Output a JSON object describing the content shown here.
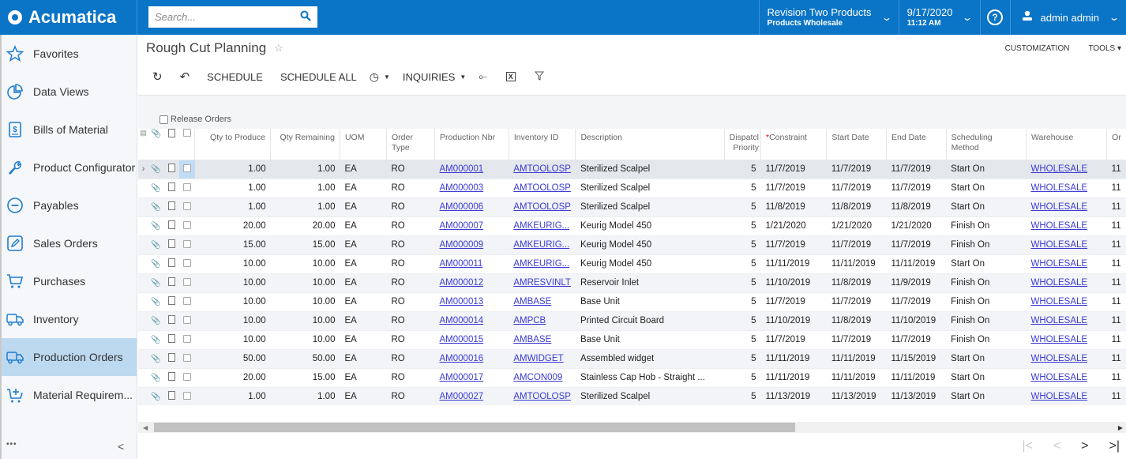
{
  "app": {
    "brand": "Acumatica"
  },
  "topbar": {
    "search_placeholder": "Search...",
    "company": {
      "line1": "Revision Two Products",
      "line2": "Products Wholesale"
    },
    "datetime": {
      "date": "9/17/2020",
      "time": "11:12 AM"
    },
    "help_label": "?",
    "user": "admin admin"
  },
  "sidebar": {
    "items": [
      {
        "label": "Favorites",
        "icon": "star-icon"
      },
      {
        "label": "Data Views",
        "icon": "pie-chart-icon"
      },
      {
        "label": "Bills of Material",
        "icon": "bill-icon"
      },
      {
        "label": "Product Configurator",
        "icon": "wrench-icon"
      },
      {
        "label": "Payables",
        "icon": "minus-circle-icon"
      },
      {
        "label": "Sales Orders",
        "icon": "edit-icon"
      },
      {
        "label": "Purchases",
        "icon": "cart-icon"
      },
      {
        "label": "Inventory",
        "icon": "truck-icon"
      },
      {
        "label": "Production Orders",
        "icon": "truck-icon",
        "active": true
      },
      {
        "label": "Material Requirem...",
        "icon": "cart-plus-icon"
      }
    ],
    "more_label": "•••",
    "collapse_label": "<"
  },
  "page": {
    "title": "Rough Cut Planning",
    "customization": "CUSTOMIZATION",
    "tools": "TOOLS"
  },
  "toolbar": {
    "schedule": "SCHEDULE",
    "schedule_all": "SCHEDULE ALL",
    "inquiries": "INQUIRIES"
  },
  "form": {
    "release_orders_label": "Release Orders",
    "release_orders_checked": false
  },
  "grid": {
    "columns": [
      "Qty to Produce",
      "Qty Remaining",
      "UOM",
      "Order Type",
      "Production Nbr",
      "Inventory ID",
      "Description",
      "Dispatch Priority",
      "Constraint",
      "Start Date",
      "End Date",
      "Scheduling Method",
      "Warehouse",
      "Or"
    ],
    "header": {
      "qty_to_produce": "Qty to Produce",
      "qty_remaining": "Qty Remaining",
      "uom": "UOM",
      "order_type": "Order Type",
      "production_nbr": "Production Nbr",
      "inventory_id": "Inventory ID",
      "description": "Description",
      "dispatch_priority": "Dispatcl Priority",
      "constraint": "Constraint",
      "start_date": "Start Date",
      "end_date": "End Date",
      "scheduling_method": "Scheduling Method",
      "warehouse": "Warehouse",
      "order_date": "Or"
    },
    "rows": [
      {
        "qty": "1.00",
        "rem": "1.00",
        "uom": "EA",
        "type": "RO",
        "nbr": "AM000001",
        "inv": "AMTOOLOSP",
        "desc": "Sterilized Scalpel",
        "prio": "5",
        "constraint": "11/7/2019",
        "start": "11/7/2019",
        "end": "11/7/2019",
        "method": "Start On",
        "wh": "WHOLESALE",
        "or": "11"
      },
      {
        "qty": "1.00",
        "rem": "1.00",
        "uom": "EA",
        "type": "RO",
        "nbr": "AM000003",
        "inv": "AMTOOLOSP",
        "desc": "Sterilized Scalpel",
        "prio": "5",
        "constraint": "11/7/2019",
        "start": "11/7/2019",
        "end": "11/7/2019",
        "method": "Start On",
        "wh": "WHOLESALE",
        "or": "11"
      },
      {
        "qty": "1.00",
        "rem": "1.00",
        "uom": "EA",
        "type": "RO",
        "nbr": "AM000006",
        "inv": "AMTOOLOSP",
        "desc": "Sterilized Scalpel",
        "prio": "5",
        "constraint": "11/8/2019",
        "start": "11/8/2019",
        "end": "11/8/2019",
        "method": "Start On",
        "wh": "WHOLESALE",
        "or": "11"
      },
      {
        "qty": "20.00",
        "rem": "20.00",
        "uom": "EA",
        "type": "RO",
        "nbr": "AM000007",
        "inv": "AMKEURIG...",
        "desc": "Keurig Model 450",
        "prio": "5",
        "constraint": "1/21/2020",
        "start": "1/21/2020",
        "end": "1/21/2020",
        "method": "Finish On",
        "wh": "WHOLESALE",
        "or": "11"
      },
      {
        "qty": "15.00",
        "rem": "15.00",
        "uom": "EA",
        "type": "RO",
        "nbr": "AM000009",
        "inv": "AMKEURIG...",
        "desc": "Keurig Model 450",
        "prio": "5",
        "constraint": "11/7/2019",
        "start": "11/7/2019",
        "end": "11/7/2019",
        "method": "Finish On",
        "wh": "WHOLESALE",
        "or": "11"
      },
      {
        "qty": "10.00",
        "rem": "10.00",
        "uom": "EA",
        "type": "RO",
        "nbr": "AM000011",
        "inv": "AMKEURIG...",
        "desc": "Keurig Model 450",
        "prio": "5",
        "constraint": "11/11/2019",
        "start": "11/11/2019",
        "end": "11/11/2019",
        "method": "Start On",
        "wh": "WHOLESALE",
        "or": "11"
      },
      {
        "qty": "10.00",
        "rem": "10.00",
        "uom": "EA",
        "type": "RO",
        "nbr": "AM000012",
        "inv": "AMRESVINLT",
        "desc": "Reservoir Inlet",
        "prio": "5",
        "constraint": "11/10/2019",
        "start": "11/8/2019",
        "end": "11/9/2019",
        "method": "Finish On",
        "wh": "WHOLESALE",
        "or": "11"
      },
      {
        "qty": "10.00",
        "rem": "10.00",
        "uom": "EA",
        "type": "RO",
        "nbr": "AM000013",
        "inv": "AMBASE",
        "desc": "Base Unit",
        "prio": "5",
        "constraint": "11/7/2019",
        "start": "11/7/2019",
        "end": "11/7/2019",
        "method": "Finish On",
        "wh": "WHOLESALE",
        "or": "11"
      },
      {
        "qty": "10.00",
        "rem": "10.00",
        "uom": "EA",
        "type": "RO",
        "nbr": "AM000014",
        "inv": "AMPCB",
        "desc": "Printed Circuit Board",
        "prio": "5",
        "constraint": "11/10/2019",
        "start": "11/8/2019",
        "end": "11/10/2019",
        "method": "Finish On",
        "wh": "WHOLESALE",
        "or": "11"
      },
      {
        "qty": "10.00",
        "rem": "10.00",
        "uom": "EA",
        "type": "RO",
        "nbr": "AM000015",
        "inv": "AMBASE",
        "desc": "Base Unit",
        "prio": "5",
        "constraint": "11/7/2019",
        "start": "11/7/2019",
        "end": "11/7/2019",
        "method": "Finish On",
        "wh": "WHOLESALE",
        "or": "11"
      },
      {
        "qty": "50.00",
        "rem": "50.00",
        "uom": "EA",
        "type": "RO",
        "nbr": "AM000016",
        "inv": "AMWIDGET",
        "desc": "Assembled widget",
        "prio": "5",
        "constraint": "11/11/2019",
        "start": "11/11/2019",
        "end": "11/15/2019",
        "method": "Start On",
        "wh": "WHOLESALE",
        "or": "11"
      },
      {
        "qty": "20.00",
        "rem": "15.00",
        "uom": "EA",
        "type": "RO",
        "nbr": "AM000017",
        "inv": "AMCON009",
        "desc": "Stainless Cap Hob - Straight ...",
        "prio": "5",
        "constraint": "11/11/2019",
        "start": "11/11/2019",
        "end": "11/11/2019",
        "method": "Start On",
        "wh": "WHOLESALE",
        "or": "11"
      },
      {
        "qty": "1.00",
        "rem": "1.00",
        "uom": "EA",
        "type": "RO",
        "nbr": "AM000027",
        "inv": "AMTOOLOSP",
        "desc": "Sterilized Scalpel",
        "prio": "5",
        "constraint": "11/13/2019",
        "start": "11/13/2019",
        "end": "11/13/2019",
        "method": "Start On",
        "wh": "WHOLESALE",
        "or": "11"
      }
    ],
    "selected_row": 0
  },
  "pager": {
    "first": "|<",
    "prev": "<",
    "next": ">",
    "last": ">|"
  },
  "colors": {
    "brand": "#0a74c6",
    "link": "#3b3bd3",
    "active_nav": "#bdd9ef",
    "required": "#dd0000"
  }
}
